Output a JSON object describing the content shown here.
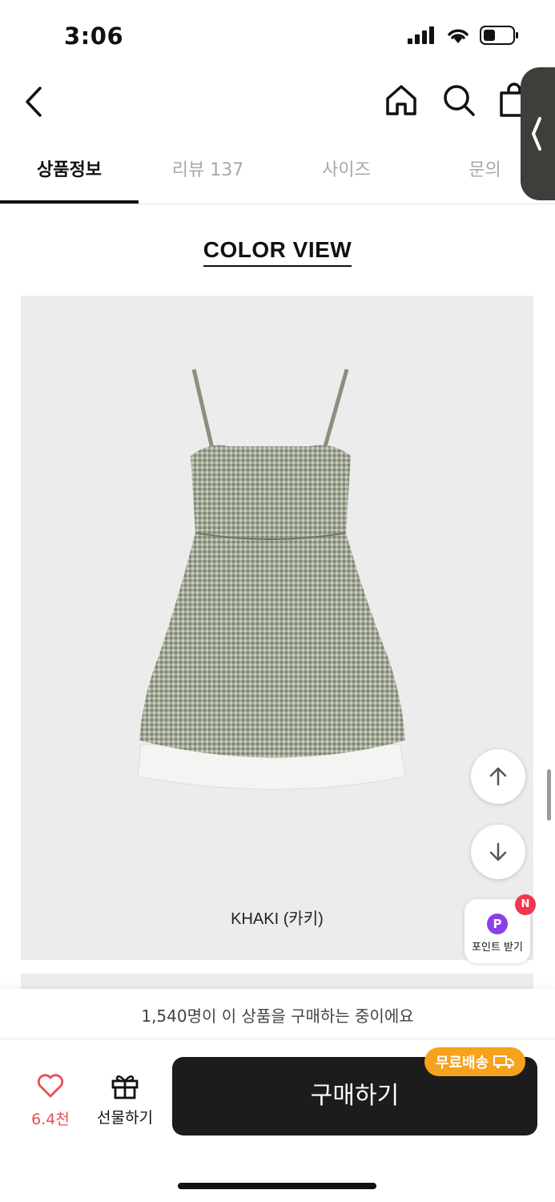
{
  "status_bar": {
    "time": "3:06",
    "signal_icon": "signal-icon",
    "wifi_icon": "wifi-icon",
    "battery_icon": "battery-icon"
  },
  "header": {
    "back_icon": "chevron-left-icon",
    "home_icon": "home-icon",
    "search_icon": "search-icon",
    "cart_icon": "shopping-bag-icon"
  },
  "tabs": [
    {
      "label": "상품정보",
      "active": true
    },
    {
      "label": "리뷰 137",
      "active": false
    },
    {
      "label": "사이즈",
      "active": false
    },
    {
      "label": "문의",
      "active": false
    }
  ],
  "content": {
    "section_title": "COLOR VIEW",
    "color_caption": "KHAKI (카키)"
  },
  "floating": {
    "scroll_up_icon": "arrow-up-icon",
    "scroll_down_icon": "arrow-down-icon",
    "point_letter": "P",
    "point_label": "포인트 받기",
    "new_badge": "N"
  },
  "bottom_bar": {
    "buyer_notice": "1,540명이 이 상품을 구매하는 중이에요",
    "like_count": "6.4천",
    "gift_label": "선물하기",
    "buy_label": "구매하기",
    "free_shipping_label": "무료배송"
  },
  "colors": {
    "accent_orange": "#f6a21c",
    "like_red": "#e6505a",
    "point_purple": "#8b3fe8",
    "buy_button": "#1c1c1c"
  }
}
